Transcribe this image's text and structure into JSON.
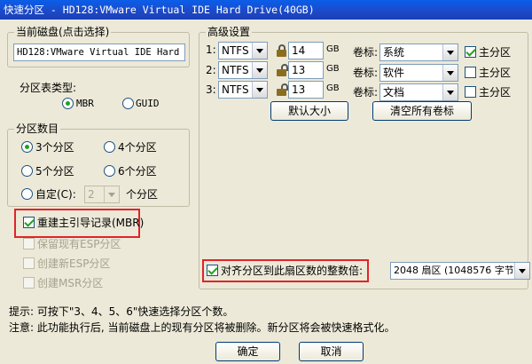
{
  "window": {
    "title": "快速分区 - HD128:VMware Virtual IDE Hard Drive(40GB)"
  },
  "disk_group": {
    "legend": "当前磁盘(点击选择)",
    "disk_value": "HD128:VMware Virtual IDE Hard Drive"
  },
  "partition_table": {
    "legend": "分区表类型:",
    "options": [
      {
        "label": "MBR",
        "selected": true
      },
      {
        "label": "GUID",
        "selected": false
      }
    ]
  },
  "partition_count": {
    "legend": "分区数目",
    "options": [
      {
        "label": "3个分区",
        "selected": true
      },
      {
        "label": "4个分区",
        "selected": false
      },
      {
        "label": "5个分区",
        "selected": false
      },
      {
        "label": "6个分区",
        "selected": false
      },
      {
        "label": "自定(C):",
        "selected": false
      }
    ],
    "custom_value": "2",
    "custom_suffix": "个分区"
  },
  "options": {
    "rebuild_mbr": {
      "label": "重建主引导记录(MBR)",
      "checked": true
    },
    "keep_esp": {
      "label": "保留现有ESP分区",
      "checked": false
    },
    "create_esp": {
      "label": "创建新ESP分区",
      "checked": false
    },
    "create_msr": {
      "label": "创建MSR分区",
      "checked": false
    }
  },
  "advanced": {
    "legend": "高级设置",
    "rows": [
      {
        "num": "1:",
        "fs": "NTFS",
        "size": "14",
        "unit": "GB",
        "vol_label": "卷标:",
        "volume": "系统",
        "primary_label": "主分区",
        "primary": true
      },
      {
        "num": "2:",
        "fs": "NTFS",
        "size": "13",
        "unit": "GB",
        "vol_label": "卷标:",
        "volume": "软件",
        "primary_label": "主分区",
        "primary": false
      },
      {
        "num": "3:",
        "fs": "NTFS",
        "size": "13",
        "unit": "GB",
        "vol_label": "卷标:",
        "volume": "文档",
        "primary_label": "主分区",
        "primary": false
      }
    ],
    "default_size_button": "默认大小",
    "clear_labels_button": "清空所有卷标",
    "align": {
      "label": "对齐分区到此扇区数的整数倍:",
      "checked": true,
      "value": "2048 扇区 (1048576 字节)"
    }
  },
  "notes": {
    "tip": "提示: 可按下\"3、4、5、6\"快速选择分区个数。",
    "warning": "注意: 此功能执行后, 当前磁盘上的现有分区将被删除。新分区将会被快速格式化。"
  },
  "buttons": {
    "ok": "确定",
    "cancel": "取消"
  }
}
